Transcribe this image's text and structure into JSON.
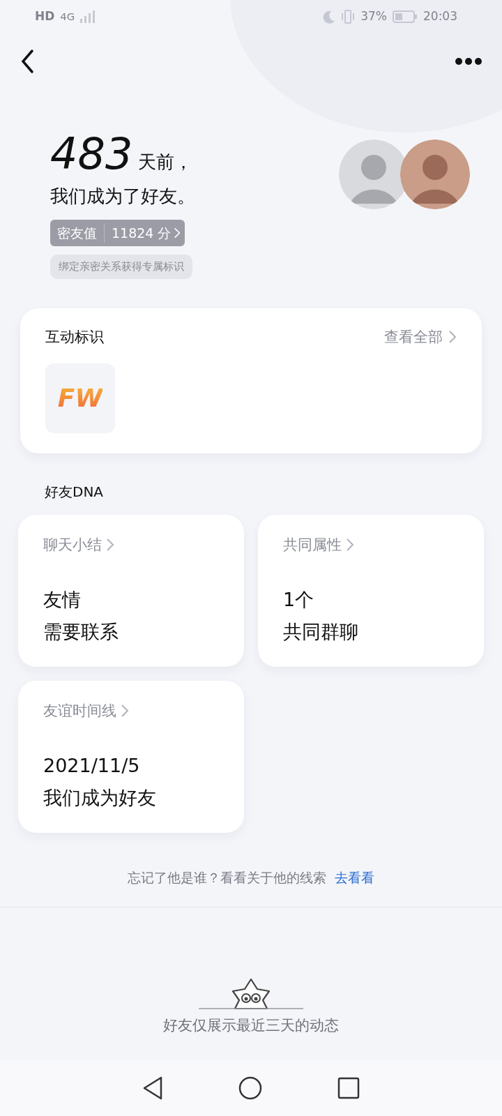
{
  "status_bar": {
    "network": "HD",
    "signal_type": "4G",
    "battery": "37%",
    "time": "20:03"
  },
  "friendship": {
    "days": "483",
    "days_suffix": "天前，",
    "sentence": "我们成为了好友。",
    "score_label": "密友值",
    "score": "11824 分",
    "tip": "绑定亲密关系获得专属标识"
  },
  "interaction": {
    "title": "互动标识",
    "view_all": "查看全部",
    "badges": [
      {
        "label": "FW"
      }
    ]
  },
  "dna": {
    "title": "好友DNA",
    "cards": [
      {
        "title": "聊天小结",
        "lines": [
          "友情",
          "需要联系"
        ]
      },
      {
        "title": "共同属性",
        "lines": [
          "1个",
          "共同群聊"
        ]
      },
      {
        "title": "友谊时间线",
        "lines": [
          "2021/11/5",
          "我们成为好友"
        ]
      }
    ]
  },
  "clue": {
    "text": "忘记了他是谁？看看关于他的线索",
    "link": "去看看"
  },
  "footer": {
    "text": "好友仅展示最近三天的动态"
  }
}
